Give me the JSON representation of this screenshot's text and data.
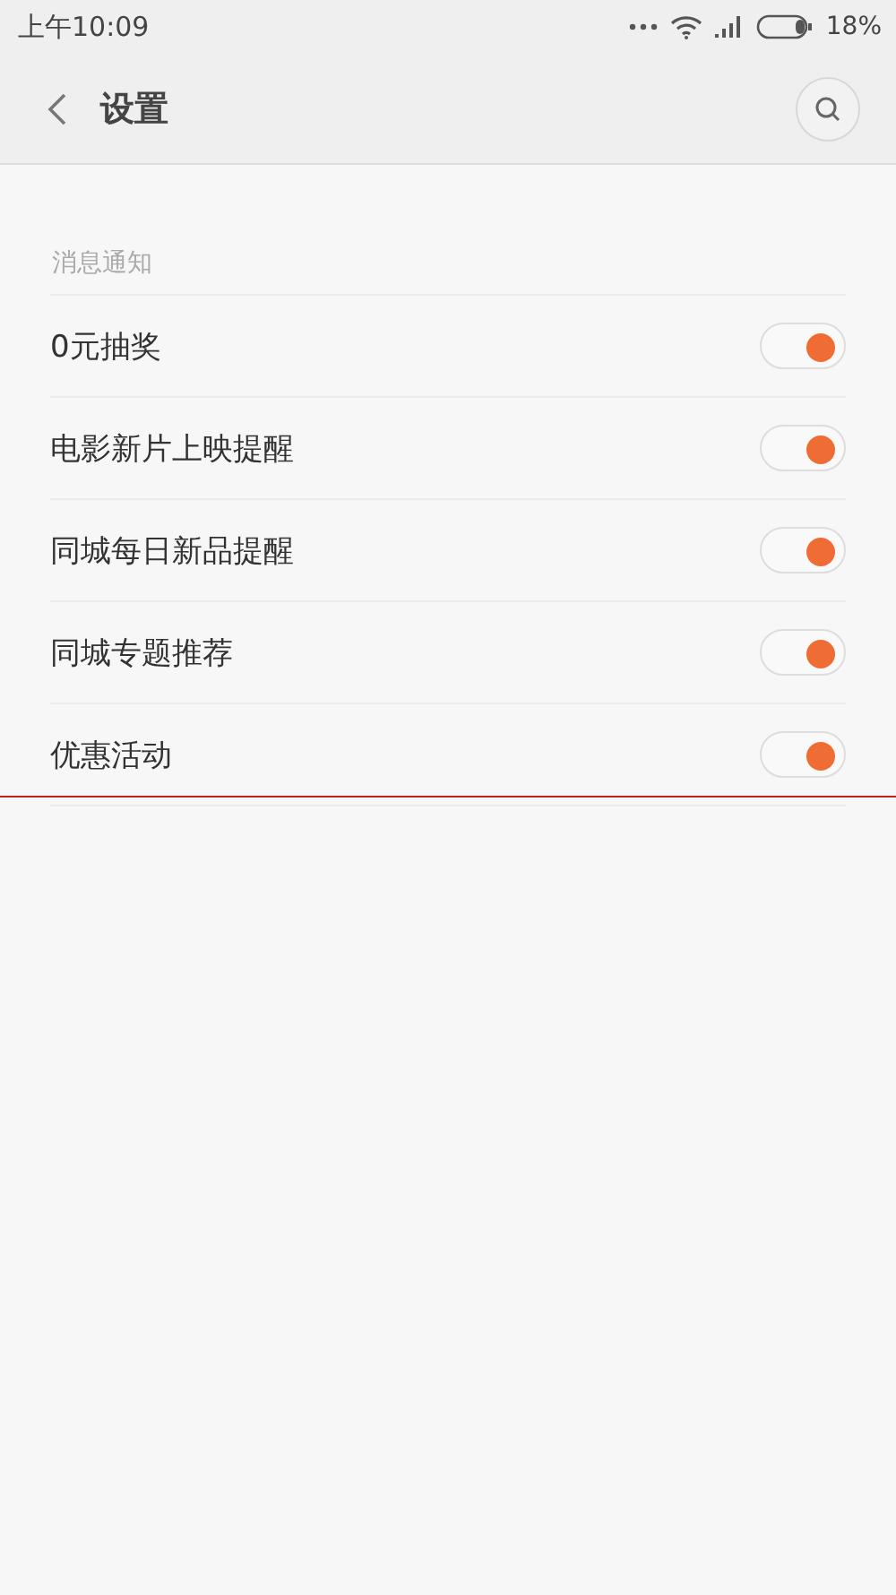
{
  "status_bar": {
    "time": "上午10:09",
    "battery_percent": "18%"
  },
  "header": {
    "title": "设置"
  },
  "section": {
    "title": "消息通知",
    "items": [
      {
        "label": "0元抽奖",
        "on": true
      },
      {
        "label": "电影新片上映提醒",
        "on": true
      },
      {
        "label": "同城每日新品提醒",
        "on": true
      },
      {
        "label": "同城专题推荐",
        "on": true
      },
      {
        "label": "优惠活动",
        "on": true
      }
    ]
  }
}
